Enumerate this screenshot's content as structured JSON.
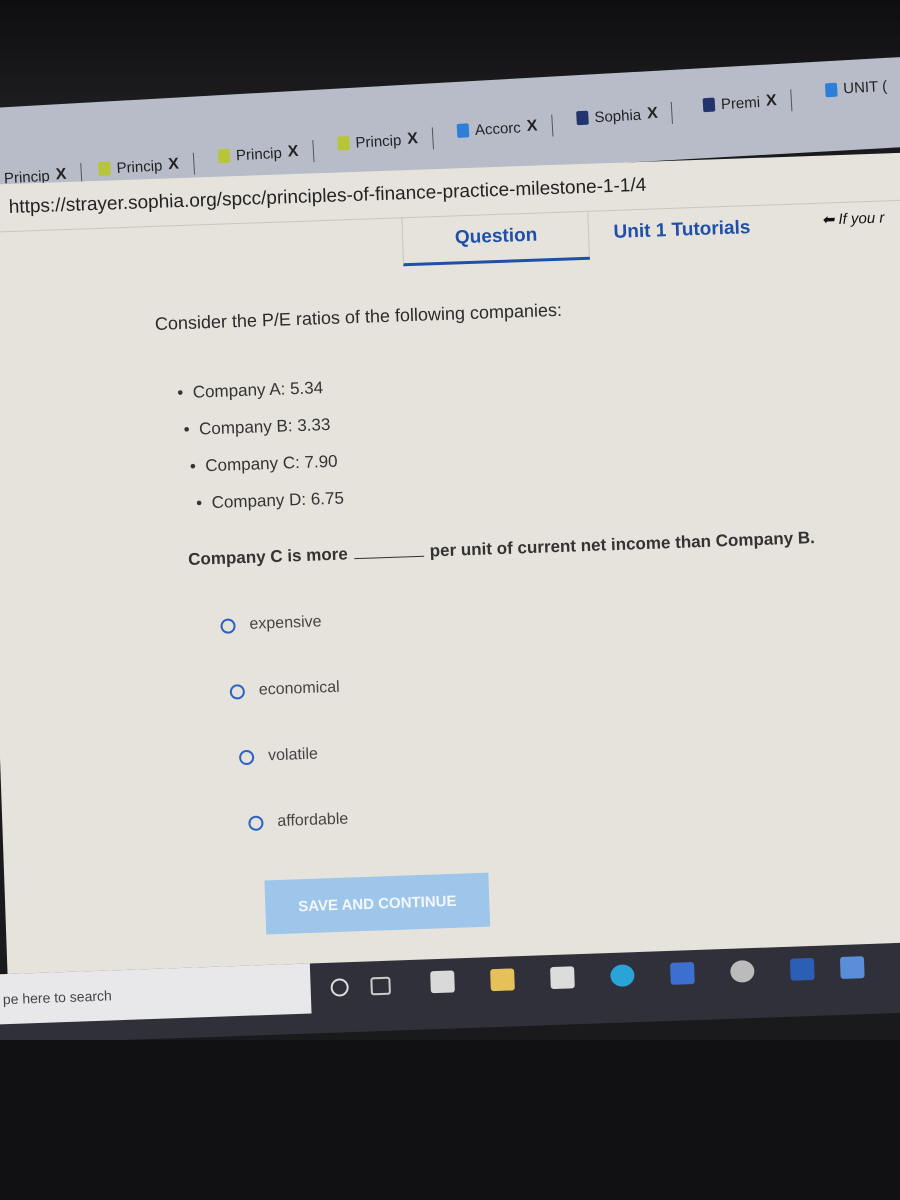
{
  "browser": {
    "tabs": [
      {
        "label": "Princip",
        "icon": "sophia-icon"
      },
      {
        "label": "Princip",
        "icon": "sophia-icon"
      },
      {
        "label": "Princip",
        "icon": "sophia-icon"
      },
      {
        "label": "Princip",
        "icon": "sophia-icon"
      },
      {
        "label": "Accorc",
        "icon": "bing-icon"
      },
      {
        "label": "Sophia",
        "icon": "shield-icon"
      },
      {
        "label": "Premi",
        "icon": "shield-icon"
      },
      {
        "label": "UNIT (",
        "icon": "bing-icon"
      }
    ],
    "close_glyph": "X",
    "url": "https://strayer.sophia.org/spcc/principles-of-finance-practice-milestone-1-1/4"
  },
  "nav": {
    "tabs": [
      {
        "label": "Question",
        "active": true
      },
      {
        "label": "Unit 1 Tutorials",
        "active": false
      }
    ],
    "hint": "If you r"
  },
  "question": {
    "prompt": "Consider the P/E ratios of the following companies:",
    "companies": [
      "Company A: 5.34",
      "Company B: 3.33",
      "Company C: 7.90",
      "Company D: 6.75"
    ],
    "stem_before": "Company C is more",
    "stem_after": "per unit of current net income than Company B.",
    "options": [
      "expensive",
      "economical",
      "volatile",
      "affordable"
    ],
    "submit_label": "SAVE AND CONTINUE"
  },
  "taskbar": {
    "search_placeholder": "pe here to search"
  },
  "colors": {
    "accent": "#1f4fa8",
    "button": "#9dc6ea",
    "radio": "#2b62c4"
  }
}
